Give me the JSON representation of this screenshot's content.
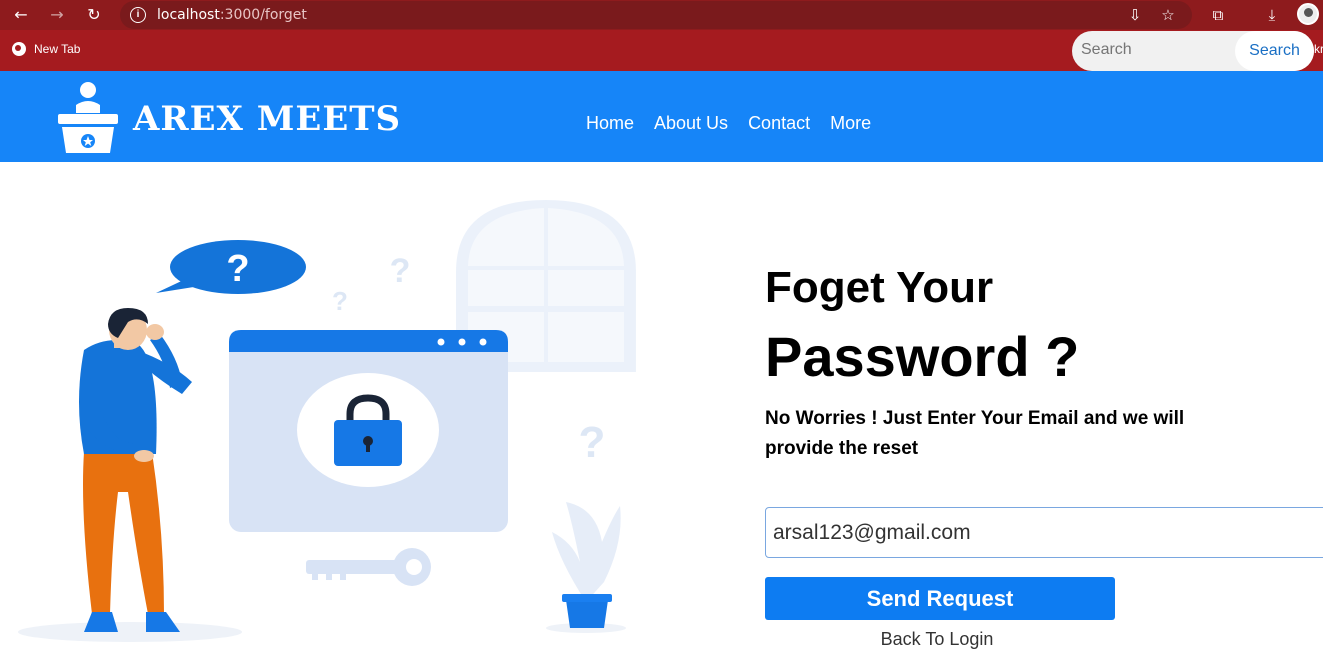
{
  "browser": {
    "url_host": "localhost",
    "url_path": ":3000/forget",
    "bookmark_newtab": "New Tab",
    "bookmark_all": "All Bookr"
  },
  "header": {
    "logo_text": "AREX MEETS",
    "nav": [
      "Home",
      "About Us",
      "Contact",
      "More"
    ],
    "search_placeholder": "Search",
    "search_button": "Search"
  },
  "form": {
    "title_line1": "Foget Your",
    "title_line2": "Password ?",
    "subtitle": "No Worries ! Just Enter Your Email and we will provide the reset",
    "email_value": "arsal123@gmail.com",
    "send_button": "Send Request",
    "back_link": "Back To Login"
  },
  "illustration": {
    "bubble_mark": "?",
    "small_marks": [
      "?",
      "?",
      "?"
    ]
  },
  "colors": {
    "header_blue": "#1685f8",
    "button_blue": "#0d7cf2",
    "chrome_red": "#8e1b1d",
    "bookmarks_red": "#a51b1f"
  }
}
